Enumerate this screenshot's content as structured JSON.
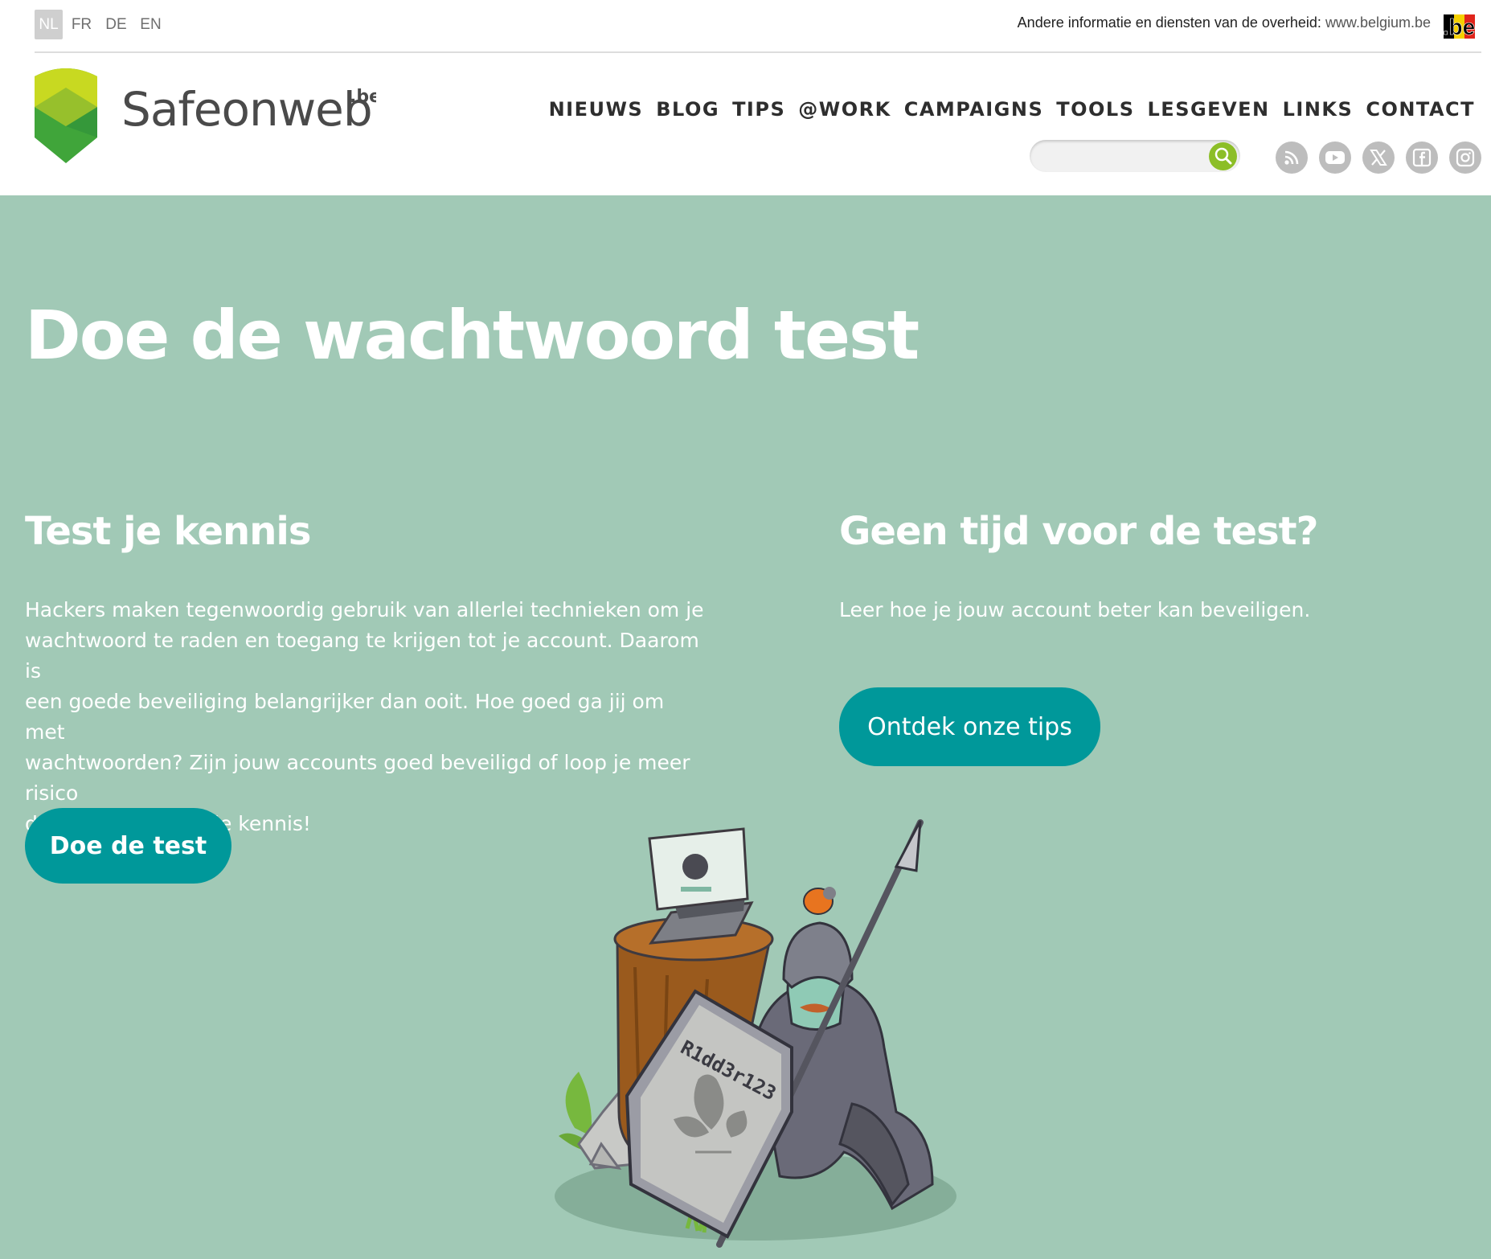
{
  "topbar": {
    "languages": [
      "NL",
      "FR",
      "DE",
      "EN"
    ],
    "active_language": "NL",
    "gov_text": "Andere informatie en diensten van de overheid:",
    "gov_link": "www.belgium.be",
    "be_logo_text": ".be"
  },
  "logo": {
    "name": "Safeonweb",
    "suffix": ".be"
  },
  "nav": {
    "items": [
      "NIEUWS",
      "BLOG",
      "TIPS",
      "@WORK",
      "CAMPAIGNS",
      "TOOLS",
      "LESGEVEN",
      "LINKS",
      "CONTACT"
    ]
  },
  "search": {
    "placeholder": "",
    "value": ""
  },
  "social_icons": [
    "rss-icon",
    "youtube-icon",
    "x-icon",
    "facebook-icon",
    "instagram-icon"
  ],
  "hero": {
    "title": "Doe de wachtwoord test",
    "left": {
      "heading": "Test je kennis",
      "lines": [
        "Hackers maken tegenwoordig gebruik van allerlei technieken om je",
        "wachtwoord te raden en toegang te krijgen tot je account. Daarom is",
        "een goede beveiliging belangrijker dan ooit. Hoe goed ga jij om met",
        "wachtwoorden? Zijn jouw accounts goed beveiligd of loop je meer risico",
        "dan je denkt? Test je kennis!"
      ],
      "button": "Doe de test"
    },
    "right": {
      "heading": "Geen tijd voor de test?",
      "text": "Leer hoe je jouw account beter kan beveiligen.",
      "button": "Ontdek onze tips"
    },
    "illustration": {
      "shield_text": "R1dd3r123"
    }
  },
  "colors": {
    "hero_bg": "#a1c9b6",
    "button_bg": "#00989a",
    "search_button": "#8cbe27",
    "social_bg": "#bdbdbd",
    "logo_text": "#4a4a4a"
  }
}
